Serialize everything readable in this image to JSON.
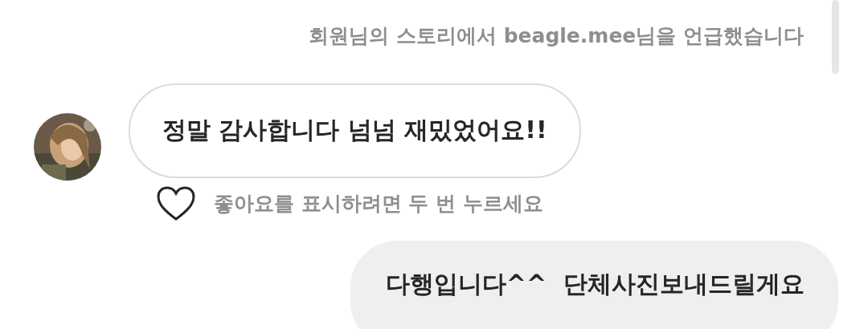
{
  "mention_notice": "회원님의 스토리에서 beagle.mee님을 언급했습니다",
  "messages": [
    {
      "kind": "received",
      "text": "정말 감사합니다 넘넘 재밌었어요!!",
      "liked": false,
      "like_hint": "좋아요를 표시하려면 두 번 누르세요"
    },
    {
      "kind": "sent",
      "text": "다행입니다^^  단체사진보내드릴게요"
    }
  ]
}
